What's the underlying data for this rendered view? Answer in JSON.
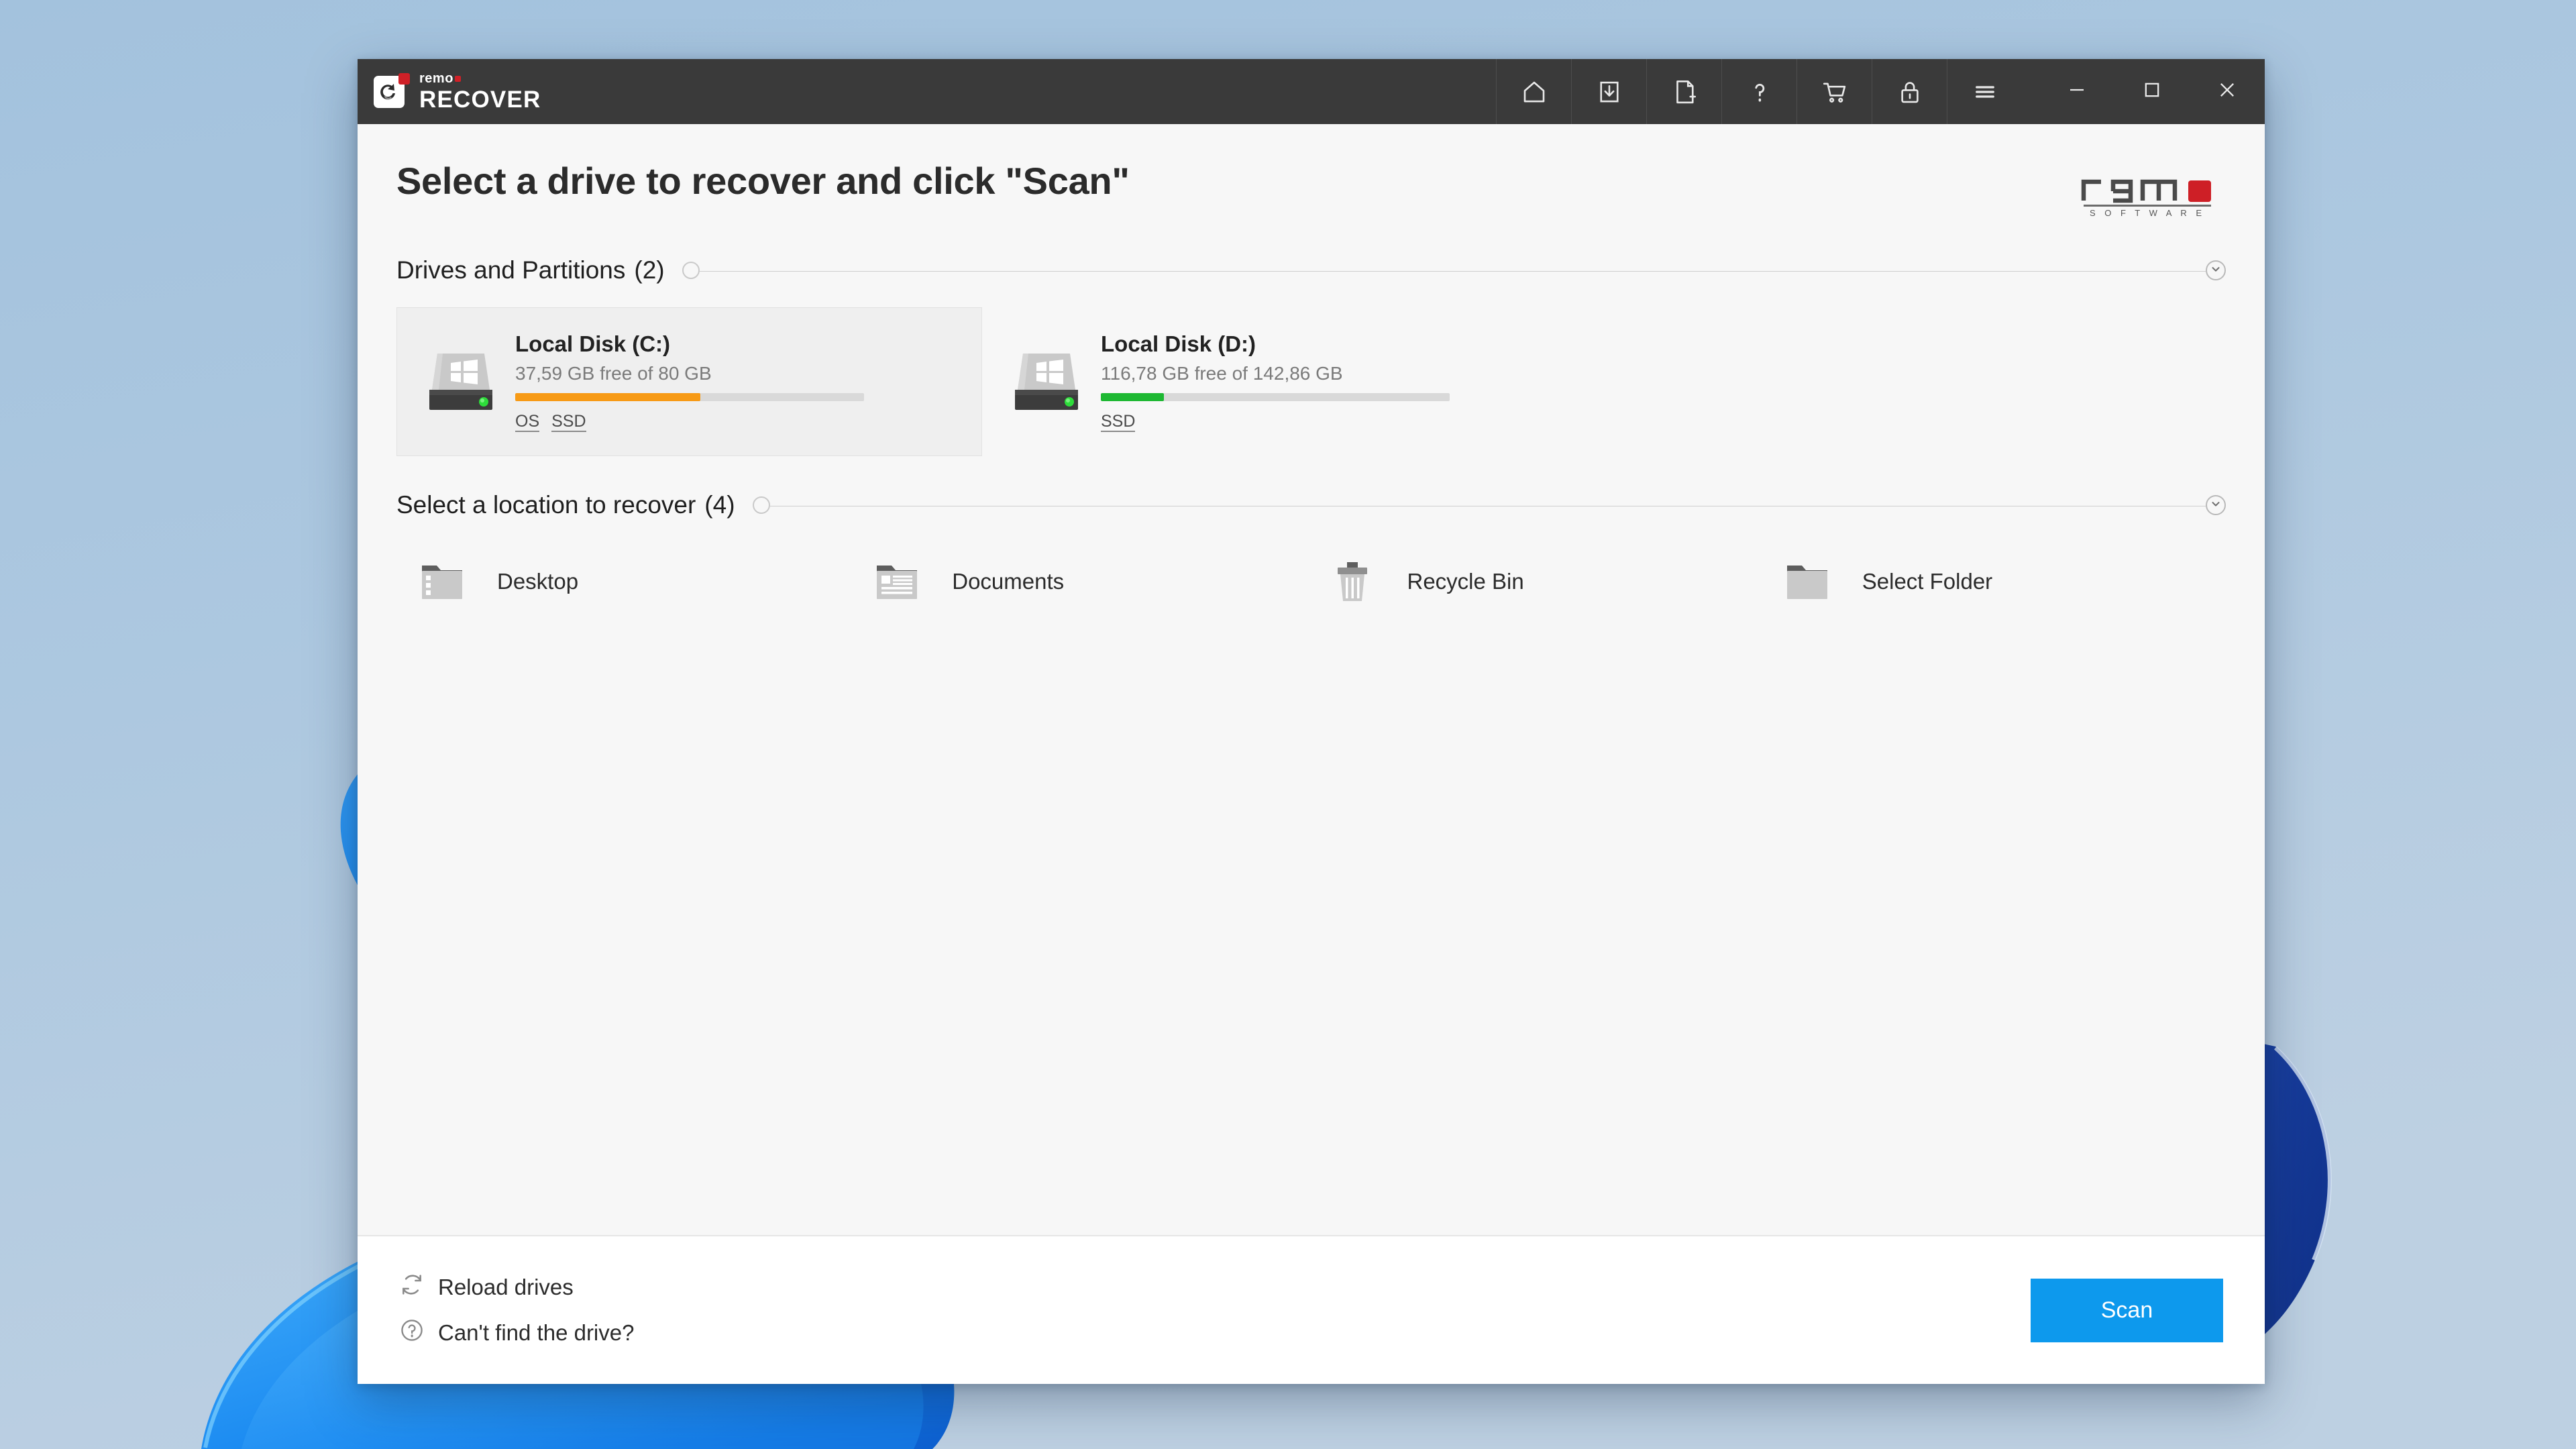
{
  "window": {
    "brand_small": "remo",
    "brand_big": "RECOVER",
    "titlebar_tools": [
      {
        "name": "home-icon",
        "label": "Home"
      },
      {
        "name": "save-session-icon",
        "label": "Save Recovery Session"
      },
      {
        "name": "new-session-icon",
        "label": "New Session"
      },
      {
        "name": "help-icon",
        "label": "Help"
      },
      {
        "name": "cart-icon",
        "label": "Buy Now"
      },
      {
        "name": "activate-lock-icon",
        "label": "Activate"
      },
      {
        "name": "menu-icon",
        "label": "Menu"
      }
    ],
    "controls": [
      {
        "name": "minimize-button",
        "label": "Minimize"
      },
      {
        "name": "maximize-button",
        "label": "Maximize"
      },
      {
        "name": "close-button",
        "label": "Close"
      }
    ]
  },
  "page": {
    "title": "Select a drive to recover and click \"Scan\"",
    "logo_word": "remo",
    "logo_sub": "S O F T W A R E"
  },
  "drives_section": {
    "title": "Drives and Partitions",
    "count": "(2)",
    "items": [
      {
        "name": "Local Disk (C:)",
        "free_text": "37,59 GB free of 80 GB",
        "used_percent": 53,
        "bar_color": "#f79a15",
        "tags": [
          "OS",
          "SSD"
        ],
        "selected": true
      },
      {
        "name": "Local Disk (D:)",
        "free_text": "116,78 GB free of 142,86 GB",
        "used_percent": 18,
        "bar_color": "#1db832",
        "tags": [
          "SSD"
        ],
        "selected": false
      }
    ]
  },
  "locations_section": {
    "title": "Select a location to recover",
    "count": "(4)",
    "items": [
      {
        "label": "Desktop",
        "icon": "desktop-folder-icon"
      },
      {
        "label": "Documents",
        "icon": "documents-folder-icon"
      },
      {
        "label": "Recycle Bin",
        "icon": "recycle-bin-icon"
      },
      {
        "label": "Select Folder",
        "icon": "folder-icon"
      }
    ]
  },
  "footer": {
    "reload_label": "Reload drives",
    "cant_find_label": "Can't find the drive?",
    "scan_label": "Scan"
  },
  "colors": {
    "titlebar": "#3a3a3a",
    "accent_red": "#cf2027",
    "scan_blue": "#0d99ed",
    "orange_bar": "#f79a15",
    "green_bar": "#1db832",
    "content_bg": "#f7f7f7",
    "selected_card": "#efefef"
  }
}
